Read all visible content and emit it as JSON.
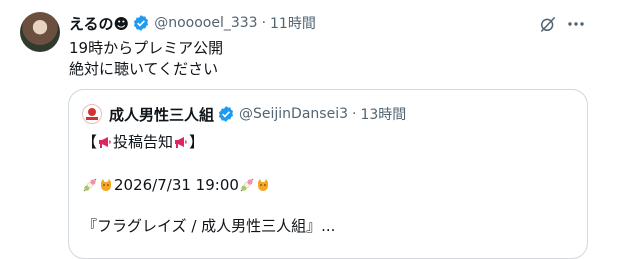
{
  "post": {
    "display_name": "えるの☻",
    "handle": "@nooooel_333",
    "separator": "·",
    "time": "11時間",
    "lines": [
      "19時からプレミア公開",
      "絶対に聴いてください"
    ]
  },
  "quoted": {
    "display_name": "成人男性三人組",
    "handle": "@SeijinDansei3",
    "separator": "·",
    "time": "13時間",
    "line1_open": "【",
    "line1_text": "投稿告知",
    "line1_close": "】",
    "date_text": "2026/7/31 19:00",
    "title_line": "『フラグレイズ / 成人男性三人組』..."
  },
  "icons": {
    "verified": "verified-badge-icon",
    "grok": "grok-icon",
    "more": "more-icon",
    "megaphone": "megaphone-icon",
    "dango": "dango-icon",
    "cat": "cat-icon"
  },
  "colors": {
    "verified": "#1d9bf0",
    "muted": "#536471",
    "border": "#cfd9de"
  }
}
